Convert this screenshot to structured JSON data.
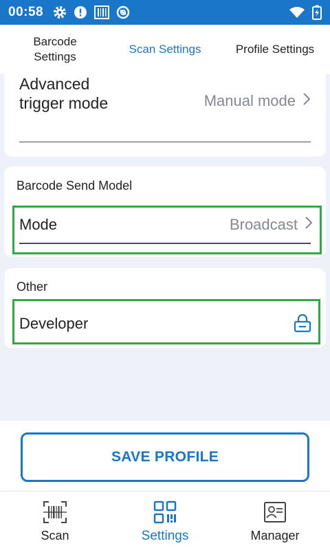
{
  "status_bar": {
    "time": "00:58",
    "icons_left": [
      "gear-icon",
      "alert-icon",
      "barcode-icon",
      "sync-icon"
    ],
    "icons_right": [
      "wifi-icon",
      "battery-charging-icon"
    ]
  },
  "tabs": [
    {
      "label": "Barcode Settings",
      "active": false
    },
    {
      "label": "Scan Settings",
      "active": true
    },
    {
      "label": "Profile Settings",
      "active": false
    }
  ],
  "trigger_section": {
    "label": "Advanced trigger mode",
    "value": "Manual mode"
  },
  "send_model_section": {
    "title": "Barcode Send Model",
    "row_label": "Mode",
    "row_value": "Broadcast"
  },
  "other_section": {
    "title": "Other",
    "row_label": "Developer",
    "row_icon": "lock-icon"
  },
  "save_button": {
    "label": "SAVE PROFILE"
  },
  "bottom_nav": [
    {
      "label": "Scan",
      "icon": "barcode-scan-icon",
      "active": false
    },
    {
      "label": "Settings",
      "icon": "qr-settings-icon",
      "active": true
    },
    {
      "label": "Manager",
      "icon": "profile-card-icon",
      "active": false
    }
  ],
  "colors": {
    "accent": "#1976c9",
    "highlight": "#2faa47",
    "background": "#eef1f7",
    "value_text": "#858892"
  }
}
